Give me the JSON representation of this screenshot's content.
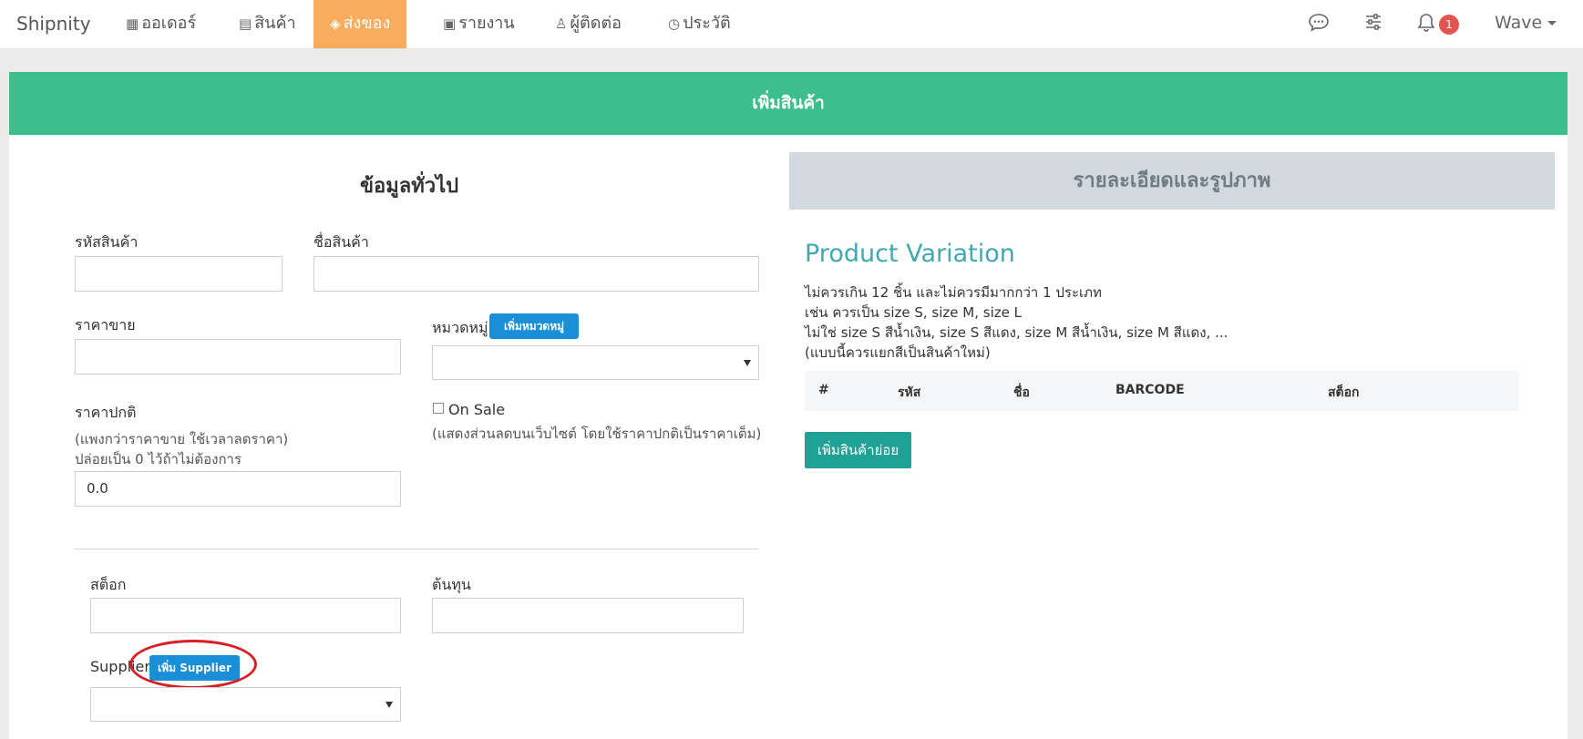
{
  "nav": {
    "brand": "Shipnity",
    "items": [
      {
        "label": "ออเดอร์",
        "icon": "orders-icon"
      },
      {
        "label": "สินค้า",
        "icon": "products-icon"
      },
      {
        "label": "ส่งของ",
        "icon": "box-icon"
      },
      {
        "label": "รายงาน",
        "icon": "report-icon"
      },
      {
        "label": "ผู้ติดต่อ",
        "icon": "user-icon"
      },
      {
        "label": "ประวัติ",
        "icon": "history-icon"
      }
    ],
    "notification_count": "1",
    "user": "Wave"
  },
  "header": {
    "title": "เพิ่มสินค้า"
  },
  "general": {
    "title": "ข้อมูลทั่วไป",
    "sku_label": "รหัสสินค้า",
    "name_label": "ชื่อสินค้า",
    "price_label": "ราคาขาย",
    "category_label": "หมวดหมู่",
    "add_category_button": "เพิ่มหมวดหมู่",
    "regular_price_label": "ราคาปกติ",
    "regular_price_hint1": "(แพงกว่าราคาขาย ใช้เวลาลดราคา)",
    "regular_price_hint2": "ปล่อยเป็น 0 ไว้ถ้าไม่ต้องการ",
    "regular_price_value": "0.0",
    "on_sale_label": "On Sale",
    "on_sale_hint": "(แสดงส่วนลดบนเว็บไซต์ โดยใช้ราคาปกติเป็นราคาเต็ม)",
    "stock_label": "สต็อก",
    "cost_label": "ต้นทุน",
    "supplier_label": "Supplier",
    "add_supplier_button": "เพิ่ม Supplier"
  },
  "right": {
    "tab_title": "รายละเอียดและรูปภาพ",
    "variation_title": "Product Variation",
    "lines": [
      "ไม่ควรเกิน 12 ชิ้น และไม่ควรมีมากกว่า 1 ประเภท",
      "เช่น ควรเป็น size S, size M, size L",
      "ไม่ใช่ size S สีน้ำเงิน, size S สีแดง, size M สีน้ำเงิน, size M สีแดง, ...",
      "(แบบนี้ควรแยกสีเป็นสินค้าใหม่)"
    ],
    "columns": [
      "#",
      "รหัส",
      "ชื่อ",
      "BARCODE",
      "สต็อก"
    ],
    "add_variant_button": "เพิ่มสินค้าย่อย"
  },
  "colors": {
    "header_green": "#3cbf8a",
    "active_tab_orange": "#f8ad5e",
    "button_blue": "#1a8ed6",
    "button_teal": "#1fa195",
    "highlight_red": "#d81f26"
  }
}
